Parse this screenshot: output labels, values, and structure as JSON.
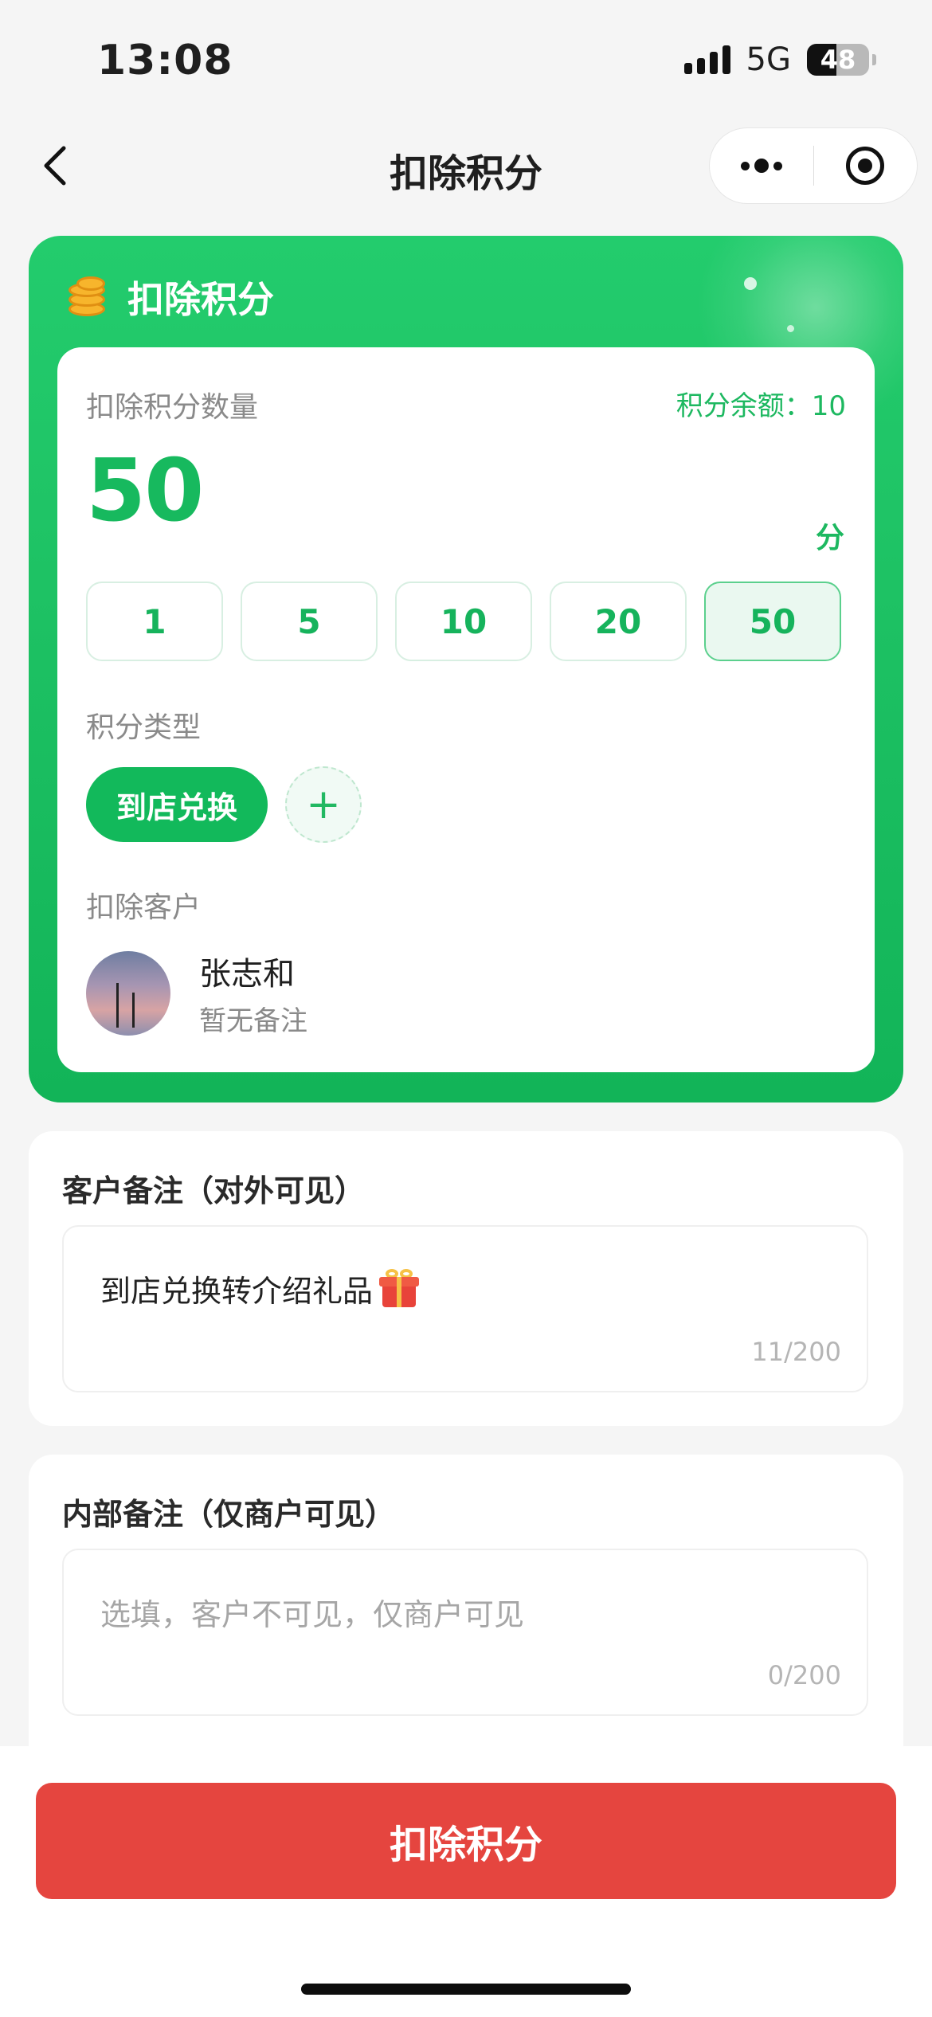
{
  "status_bar": {
    "time": "13:08",
    "network": "5G",
    "battery": "48",
    "battery_level": 0.48
  },
  "nav": {
    "title": "扣除积分"
  },
  "points_card": {
    "title": "扣除积分",
    "amount_label": "扣除积分数量",
    "balance_text": "积分余额：10",
    "amount": "50",
    "unit": "分",
    "quick_amounts": [
      "1",
      "5",
      "10",
      "20",
      "50"
    ],
    "selected_amount": "50",
    "type_label": "积分类型",
    "type_selected": "到店兑换",
    "add_type": "+",
    "customer_label": "扣除客户",
    "customer": {
      "name": "张志和",
      "note": "暂无备注"
    }
  },
  "customer_remark": {
    "title": "客户备注（对外可见）",
    "value": "到店兑换转介绍礼品",
    "emoji": "gift-icon",
    "count": "11/200"
  },
  "internal_remark": {
    "title": "内部备注（仅商户可见）",
    "placeholder": "选填，客户不可见，仅商户可见",
    "count": "0/200"
  },
  "submit": {
    "label": "扣除积分"
  },
  "colors": {
    "green": "#1ec264",
    "red": "#e5453f"
  }
}
